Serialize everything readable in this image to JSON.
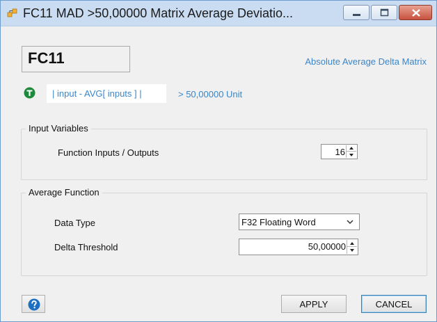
{
  "window": {
    "title": "FC11 MAD >50,00000 Matrix Average Deviatio...",
    "titlebar_color": "#c9dcf2"
  },
  "header": {
    "function_id": "FC11",
    "description": "Absolute Average Delta Matrix",
    "formula": "| input - AVG[ inputs ] |",
    "threshold_text": "> 50,00000 Unit",
    "accent_color": "#3a86c8",
    "status_icon": "green-t-circle-icon"
  },
  "input_variables": {
    "legend": "Input Variables",
    "io_label": "Function Inputs / Outputs",
    "io_value": "16"
  },
  "average_function": {
    "legend": "Average Function",
    "data_type_label": "Data Type",
    "data_type_value": "F32 Floating Word",
    "delta_label": "Delta Threshold",
    "delta_value": "50,00000"
  },
  "footer": {
    "apply_label": "APPLY",
    "cancel_label": "CANCEL",
    "help_icon": "help-question-icon"
  }
}
